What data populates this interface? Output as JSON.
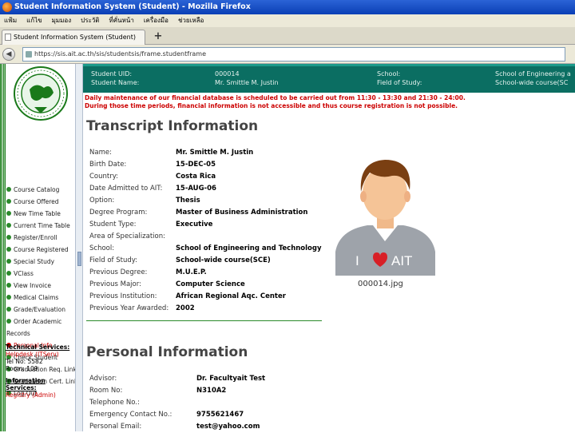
{
  "window": {
    "title": "Student Information System (Student) - Mozilla Firefox"
  },
  "menu": [
    "แฟ้ม",
    "แก้ไข",
    "มุมมอง",
    "ประวัติ",
    "ที่คั่นหน้า",
    "เครื่องมือ",
    "ช่วยเหลือ"
  ],
  "tab": {
    "label": "Student Information System (Student)",
    "new": "+"
  },
  "nav": {
    "url": "https://sis.ait.ac.th/sis/studentsis/frame.studentframe",
    "back": "◀",
    "fwd": "▶"
  },
  "header": {
    "id_label": "Student UID:",
    "id_value": "000014",
    "name_label": "Student Name:",
    "name_value": "Mr. Smittle M. Justin",
    "school_label": "School:",
    "school_value": "School of Engineering a",
    "field_label": "Field of Study:",
    "field_value": "School-wide course(SC"
  },
  "maintenance": [
    "Daily maintenance of our financial database is scheduled to be carried out from 11:30 - 13:30 and 21:30 - 24:00.",
    "During those time periods, financial information is not accessible and thus course registration is not possible."
  ],
  "sidebar": {
    "items": [
      "Course Catalog",
      "Course Offered",
      "New Time Table",
      "Current Time Table",
      "Register/Enroll",
      "Course Registered",
      "Special Study",
      "VClass",
      "View Invoice",
      "Medical Claims",
      "Grade/Evaluation",
      "Order Academic",
      "Records",
      "Personal Info",
      "Check Student",
      "Graduation Req. Link",
      "Graduation Cert. Link",
      "Log Out"
    ],
    "tech_title": "Technical Services:",
    "tech_name": "Helpdesk (ITServ)",
    "tech_tel": "Tel No: 5582",
    "tech_room": "Room: 109",
    "info_title": "Information",
    "info_title2": "Services:",
    "info_name": "Registry (Admin)"
  },
  "transcript": {
    "title": "Transcript Information",
    "rows": [
      {
        "label": "Name:",
        "value": "Mr. Smittle M. Justin"
      },
      {
        "label": "Birth Date:",
        "value": "15-DEC-05"
      },
      {
        "label": "Country:",
        "value": "Costa Rica"
      },
      {
        "label": "Date Admitted to AIT:",
        "value": "15-AUG-06"
      },
      {
        "label": "Option:",
        "value": "Thesis"
      },
      {
        "label": "Degree Program:",
        "value": "Master of Business Administration"
      },
      {
        "label": "Student Type:",
        "value": "Executive"
      },
      {
        "label": "Area of Specialization:",
        "value": ""
      },
      {
        "label": "School:",
        "value": "School of Engineering and Technology"
      },
      {
        "label": "Field of Study:",
        "value": "School-wide course(SCE)"
      },
      {
        "label": "Previous Degree:",
        "value": "M.U.E.P."
      },
      {
        "label": "Previous Major:",
        "value": "Computer Science"
      },
      {
        "label": "Previous Institution:",
        "value": "African Regional Aqc. Center"
      },
      {
        "label": "Previous Year Awarded:",
        "value": "2002"
      }
    ]
  },
  "photo": {
    "caption": "000014.jpg",
    "shirt_text_i": "I",
    "shirt_text_ait": "AIT"
  },
  "personal": {
    "title": "Personal Information",
    "rows": [
      {
        "label": "Advisor:",
        "value": "Dr. Facultyait Test"
      },
      {
        "label": "Room No:",
        "value": "N310A2"
      },
      {
        "label": "Telephone No.:",
        "value": ""
      },
      {
        "label": "Emergency Contact No.:",
        "value": "9755621467"
      },
      {
        "label": "Personal Email:",
        "value": "test@yahoo.com"
      }
    ]
  },
  "colors": {
    "header_bg": "#0b6e62",
    "maint_red": "#cc0000",
    "accent_green": "#2a8a2a"
  }
}
